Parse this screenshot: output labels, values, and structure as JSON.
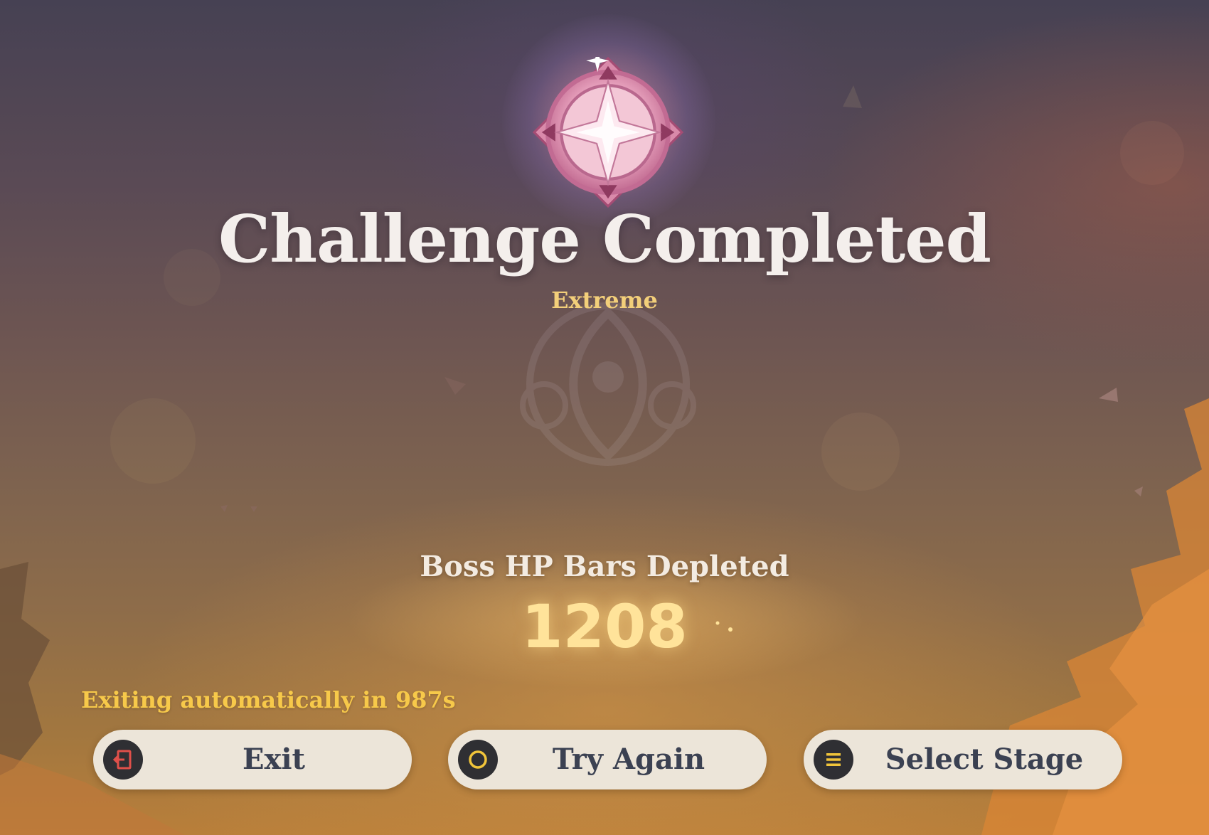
{
  "result": {
    "title": "Challenge Completed",
    "difficulty": "Extreme"
  },
  "metric": {
    "label": "Boss HP Bars Depleted",
    "value": "1208"
  },
  "countdown_text": "Exiting automatically in 987s",
  "buttons": {
    "exit": {
      "label": "Exit",
      "icon": "exit-door-icon",
      "icon_color": "#e0504a"
    },
    "retry": {
      "label": "Try Again",
      "icon": "ring-icon",
      "icon_color": "#f0c43a"
    },
    "select_stage": {
      "label": "Select Stage",
      "icon": "menu-list-icon",
      "icon_color": "#f0c43a"
    }
  },
  "colors": {
    "title": "#f4efec",
    "difficulty": "#f3cf7a",
    "metric_value": "#ffe39a",
    "countdown": "#f7c94a",
    "button_bg": "#ece5d9",
    "button_text": "#3b4152"
  }
}
